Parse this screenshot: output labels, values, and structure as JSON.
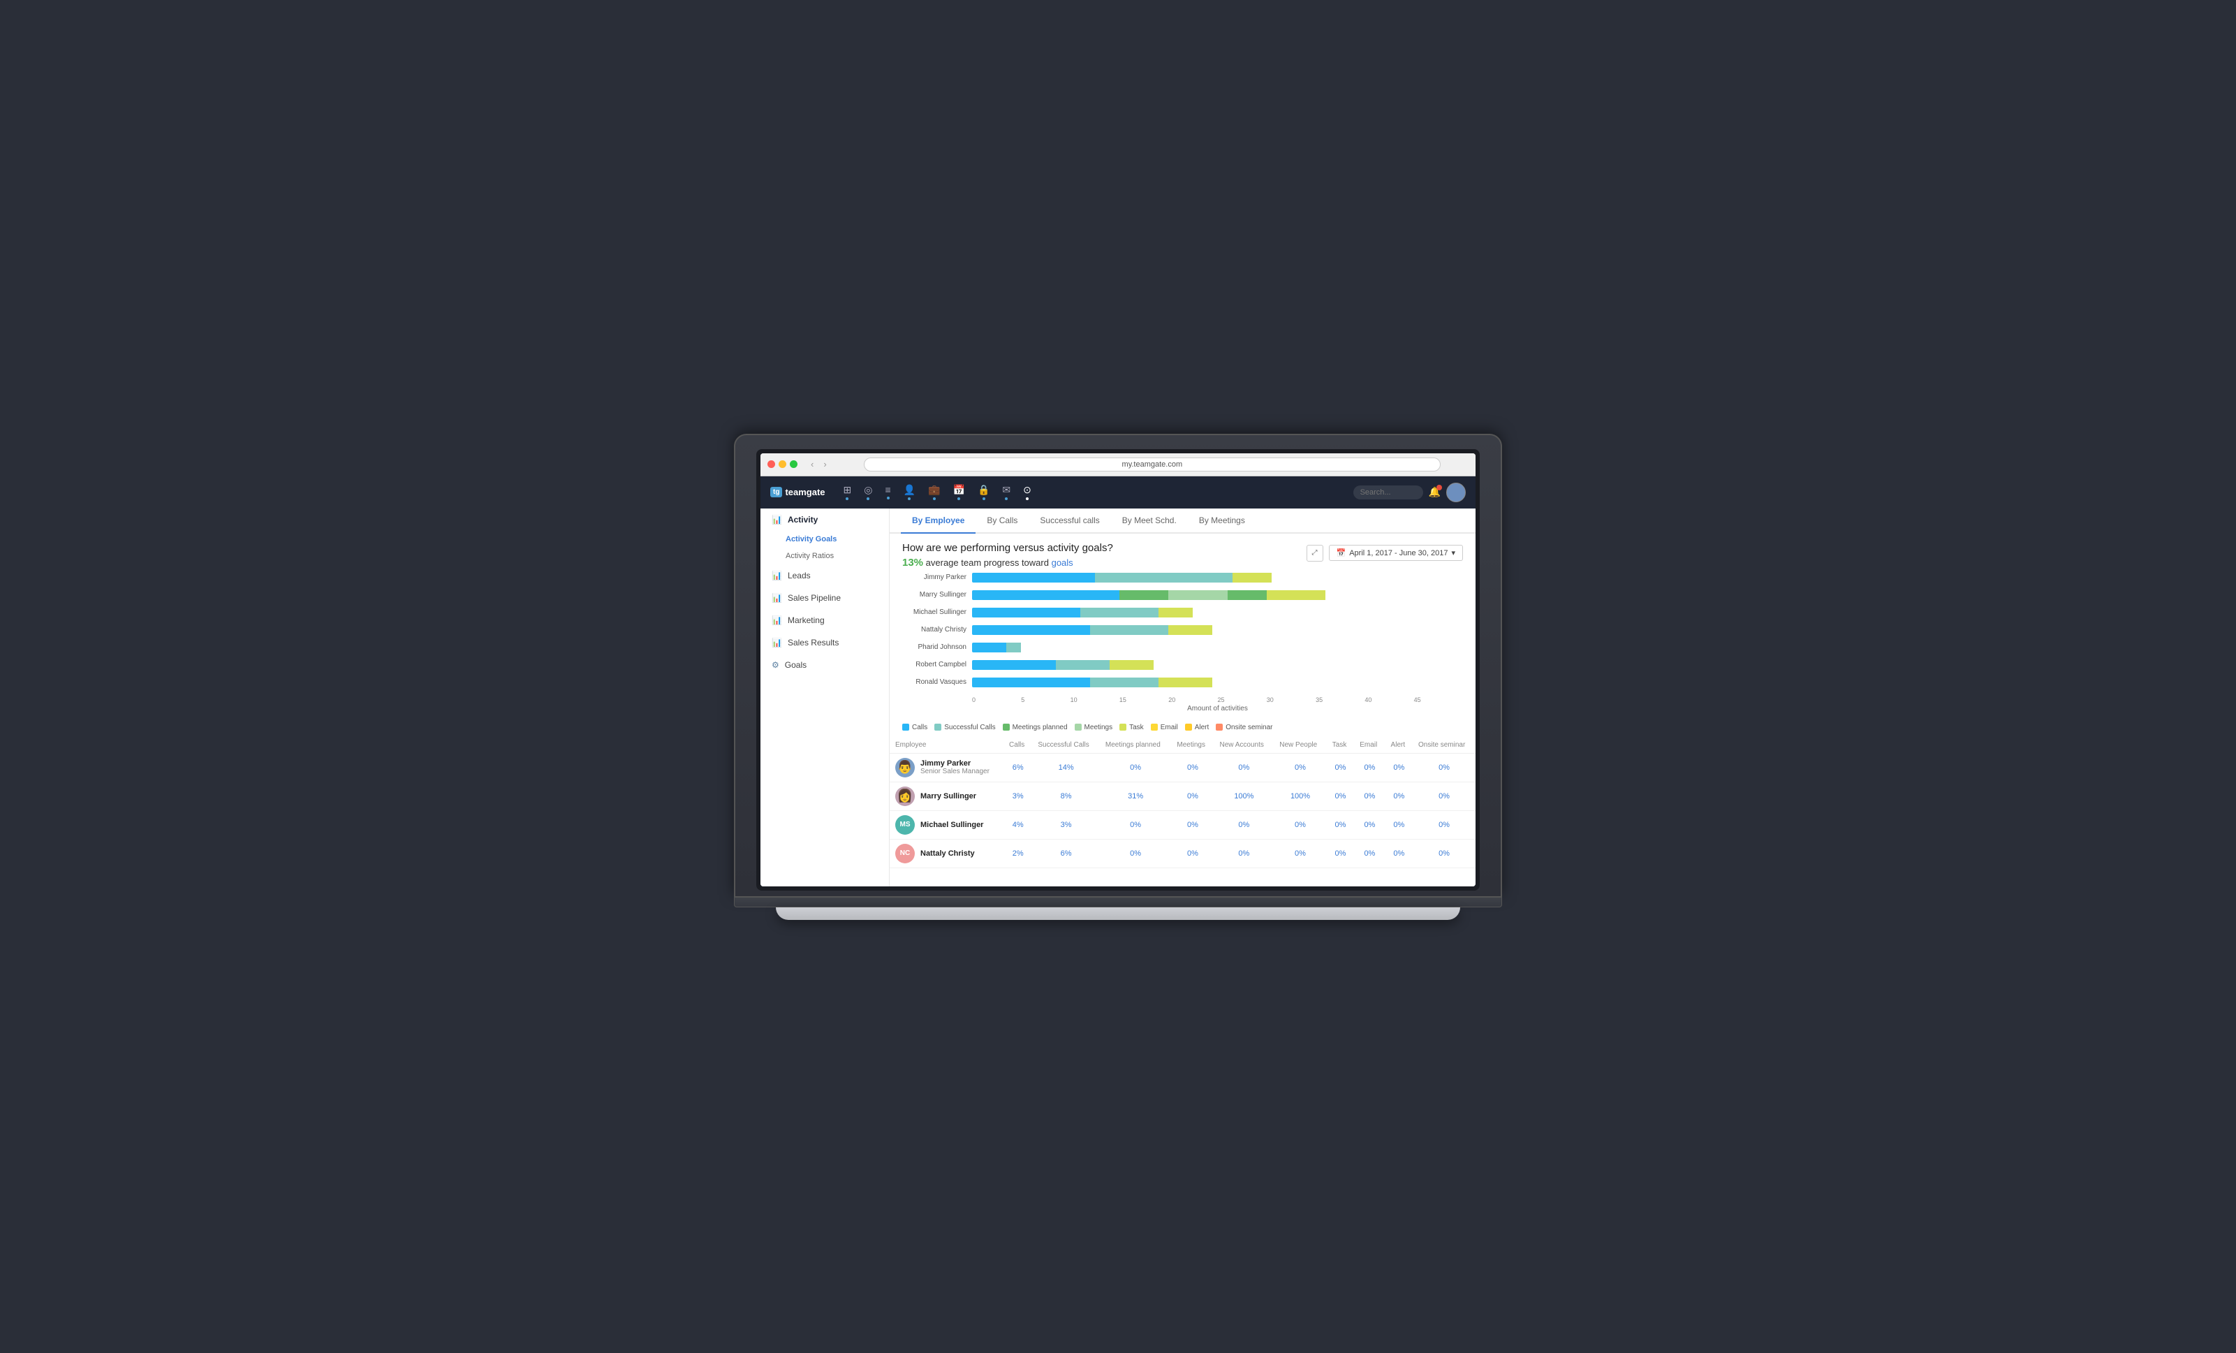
{
  "browser": {
    "url": "my.teamgate.com"
  },
  "logo": {
    "text": "teamgate",
    "icon": "tg"
  },
  "nav": {
    "icons": [
      "⊞",
      "◎",
      "≡",
      "👤",
      "💼",
      "📅",
      "🔒",
      "✉",
      "⊙"
    ],
    "active_index": 8
  },
  "sidebar": {
    "items": [
      {
        "id": "activity",
        "label": "Activity",
        "icon": "📊",
        "active": true
      },
      {
        "id": "activity-goals",
        "label": "Activity Goals",
        "sub": true,
        "active": false
      },
      {
        "id": "activity-ratios",
        "label": "Activity Ratios",
        "sub": true,
        "active": false
      },
      {
        "id": "leads",
        "label": "Leads",
        "icon": "📊",
        "active": false
      },
      {
        "id": "sales-pipeline",
        "label": "Sales Pipeline",
        "icon": "📊",
        "active": false
      },
      {
        "id": "marketing",
        "label": "Marketing",
        "icon": "📊",
        "active": false
      },
      {
        "id": "sales-results",
        "label": "Sales Results",
        "icon": "📊",
        "active": false
      },
      {
        "id": "goals",
        "label": "Goals",
        "icon": "⚙",
        "active": false
      }
    ]
  },
  "tabs": {
    "items": [
      {
        "id": "by-employee",
        "label": "By Employee",
        "active": true
      },
      {
        "id": "by-calls",
        "label": "By Calls",
        "active": false
      },
      {
        "id": "successful-calls",
        "label": "Successful calls",
        "active": false
      },
      {
        "id": "by-meet-schd",
        "label": "By Meet Schd.",
        "active": false
      },
      {
        "id": "by-meetings",
        "label": "By Meetings",
        "active": false
      }
    ]
  },
  "report": {
    "title": "How are we performing versus activity goals?",
    "subtitle_percent": "13%",
    "subtitle_text": " average team progress toward ",
    "subtitle_highlight": "goals",
    "date_range": "April 1, 2017 - June 30, 2017",
    "x_axis_labels": [
      "0",
      "5",
      "10",
      "15",
      "20",
      "25",
      "30",
      "35",
      "40",
      "45"
    ],
    "x_axis_title": "Amount of activities"
  },
  "chart": {
    "employees": [
      {
        "name": "Jimmy Parker",
        "bars": [
          {
            "type": "calls",
            "width_pct": 25
          },
          {
            "type": "successful",
            "width_pct": 28
          },
          {
            "type": "task",
            "width_pct": 8
          }
        ]
      },
      {
        "name": "Marry Sullinger",
        "bars": [
          {
            "type": "calls",
            "width_pct": 30
          },
          {
            "type": "meetings-planned",
            "width_pct": 10
          },
          {
            "type": "meetings",
            "width_pct": 12
          },
          {
            "type": "meetings-planned",
            "width_pct": 8
          },
          {
            "type": "task",
            "width_pct": 12
          }
        ]
      },
      {
        "name": "Michael Sullinger",
        "bars": [
          {
            "type": "calls",
            "width_pct": 22
          },
          {
            "type": "successful",
            "width_pct": 16
          },
          {
            "type": "task",
            "width_pct": 7
          }
        ]
      },
      {
        "name": "Nattaly Christy",
        "bars": [
          {
            "type": "calls",
            "width_pct": 24
          },
          {
            "type": "successful",
            "width_pct": 16
          },
          {
            "type": "task",
            "width_pct": 9
          }
        ]
      },
      {
        "name": "Pharid Johnson",
        "bars": [
          {
            "type": "calls",
            "width_pct": 7
          },
          {
            "type": "successful",
            "width_pct": 3
          }
        ]
      },
      {
        "name": "Robert Campbel",
        "bars": [
          {
            "type": "calls",
            "width_pct": 17
          },
          {
            "type": "successful",
            "width_pct": 11
          },
          {
            "type": "task",
            "width_pct": 9
          }
        ]
      },
      {
        "name": "Ronald Vasques",
        "bars": [
          {
            "type": "calls",
            "width_pct": 24
          },
          {
            "type": "successful",
            "width_pct": 14
          },
          {
            "type": "task",
            "width_pct": 11
          }
        ]
      }
    ]
  },
  "legend": [
    {
      "label": "Calls",
      "color": "#29b6f6"
    },
    {
      "label": "Successful Calls",
      "color": "#80cbc4"
    },
    {
      "label": "Meetings planned",
      "color": "#66bb6a"
    },
    {
      "label": "Meetings",
      "color": "#a5d6a7"
    },
    {
      "label": "Task",
      "color": "#d4e157"
    },
    {
      "label": "Email",
      "color": "#fdd835"
    },
    {
      "label": "Alert",
      "color": "#ffca28"
    },
    {
      "label": "Onsite seminar",
      "color": "#ff8a65"
    }
  ],
  "table": {
    "columns": [
      "Employee",
      "Calls",
      "Successful Calls",
      "Meetings planned",
      "Meetings",
      "New Accounts",
      "New People",
      "Task",
      "Email",
      "Alert",
      "Onsite seminar"
    ],
    "rows": [
      {
        "name": "Jimmy Parker",
        "title": "Senior Sales Manager",
        "avatar_color": "#7b9fc7",
        "avatar_initials": "",
        "avatar_type": "photo",
        "calls": "6%",
        "successful_calls": "14%",
        "meetings_planned": "0%",
        "meetings": "0%",
        "new_accounts": "0%",
        "new_people": "0%",
        "task": "0%",
        "email": "0%",
        "alert": "0%",
        "onsite": "0%"
      },
      {
        "name": "Marry Sullinger",
        "title": "",
        "avatar_color": "#b0a0c0",
        "avatar_initials": "",
        "avatar_type": "photo",
        "calls": "3%",
        "successful_calls": "8%",
        "meetings_planned": "31%",
        "meetings": "0%",
        "new_accounts": "100%",
        "new_people": "100%",
        "task": "0%",
        "email": "0%",
        "alert": "0%",
        "onsite": "0%"
      },
      {
        "name": "Michael Sullinger",
        "title": "",
        "avatar_color": "#4db6ac",
        "avatar_initials": "MS",
        "avatar_type": "initials",
        "calls": "4%",
        "successful_calls": "3%",
        "meetings_planned": "0%",
        "meetings": "0%",
        "new_accounts": "0%",
        "new_people": "0%",
        "task": "0%",
        "email": "0%",
        "alert": "0%",
        "onsite": "0%"
      },
      {
        "name": "Nattaly Christy",
        "title": "",
        "avatar_color": "#ef9a9a",
        "avatar_initials": "NC",
        "avatar_type": "initials",
        "calls": "2%",
        "successful_calls": "6%",
        "meetings_planned": "0%",
        "meetings": "0%",
        "new_accounts": "0%",
        "new_people": "0%",
        "task": "0%",
        "email": "0%",
        "alert": "0%",
        "onsite": "0%"
      }
    ]
  }
}
